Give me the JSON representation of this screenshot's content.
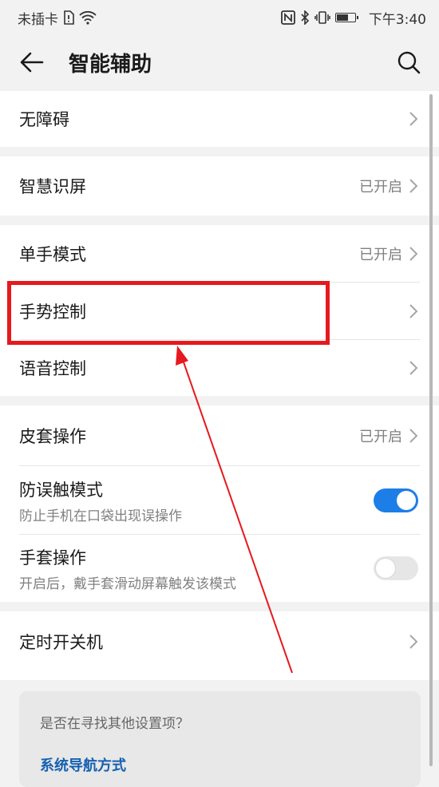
{
  "statusbar": {
    "carrier": "未插卡",
    "time": "下午3:40"
  },
  "header": {
    "title": "智能辅助",
    "back_icon": "arrow-left-icon",
    "search_icon": "search-icon"
  },
  "items": {
    "accessibility": {
      "label": "无障碍"
    },
    "smart_screen": {
      "label": "智慧识屏",
      "status": "已开启"
    },
    "one_hand": {
      "label": "单手模式",
      "status": "已开启"
    },
    "gesture": {
      "label": "手势控制"
    },
    "voice": {
      "label": "语音控制"
    },
    "cover": {
      "label": "皮套操作",
      "status": "已开启"
    },
    "pocket": {
      "label": "防误触模式",
      "sub": "防止手机在口袋出现误操作",
      "toggle": "on"
    },
    "glove": {
      "label": "手套操作",
      "sub": "开启后，戴手套滑动屏幕触发该模式",
      "toggle": "off"
    },
    "timer": {
      "label": "定时开关机"
    }
  },
  "suggestion": {
    "question": "是否在寻找其他设置项？",
    "link": "系统导航方式"
  },
  "colors": {
    "accent": "#1e7ee8",
    "highlight": "#e6191e",
    "link": "#1660b0"
  }
}
